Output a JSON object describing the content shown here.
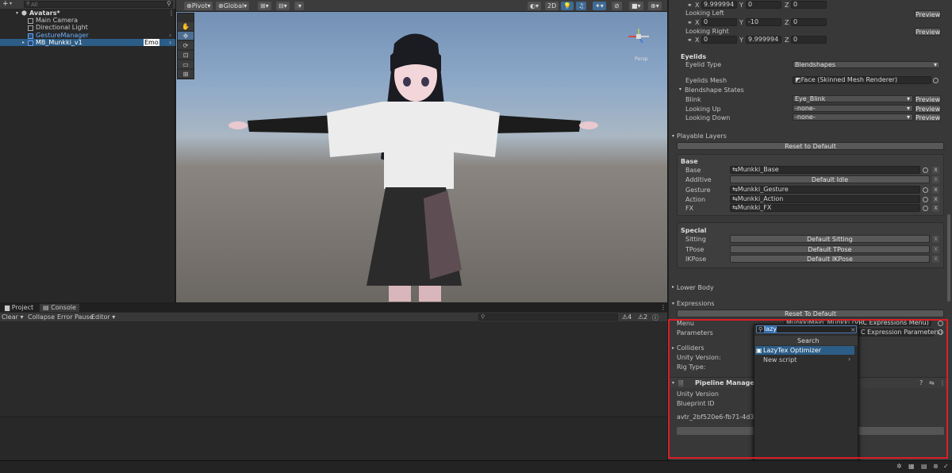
{
  "hierarchy": {
    "add": "+",
    "search_placeholder": "All",
    "root": "Avatars*",
    "items": [
      {
        "label": "Main Camera"
      },
      {
        "label": "Directional Light"
      },
      {
        "label": "GestureManager"
      },
      {
        "label": "MB_Munkki_v1",
        "badge": "Emo"
      }
    ]
  },
  "scene_toolbar": {
    "pivot": "Pivot",
    "global": "Global",
    "mode_2d": "2D"
  },
  "scene_tools": [
    "hand-icon",
    "move-icon",
    "rotate-icon",
    "scale-icon",
    "rect-icon",
    "transform-icon"
  ],
  "bottom": {
    "tabs": [
      "Project",
      "Console"
    ],
    "console_buttons": [
      "Clear",
      "Collapse",
      "Error Pause",
      "Editor"
    ],
    "warnings_count": "4",
    "errors_count": "2"
  },
  "inspector": {
    "top_vec": {
      "x": "9.999994",
      "y": "0",
      "z": "0"
    },
    "looking_left": {
      "label": "Looking Left",
      "x": "0",
      "y": "-10",
      "z": "0"
    },
    "looking_right": {
      "label": "Looking Right",
      "x": "0",
      "y": "9.999994",
      "z": "0"
    },
    "preview": "Preview",
    "eyelids": {
      "header": "Eyelids",
      "type_label": "Eyelid Type",
      "type_value": "Blendshapes",
      "mesh_label": "Eyelids Mesh",
      "mesh_value": "Face (Skinned Mesh Renderer)",
      "states_label": "Blendshape States",
      "rows": [
        {
          "label": "Blink",
          "value": "Eye_Blink"
        },
        {
          "label": "Looking Up",
          "value": "-none-"
        },
        {
          "label": "Looking Down",
          "value": "-none-"
        }
      ]
    },
    "playable": {
      "header": "Playable Layers",
      "reset": "Reset to Default",
      "base_header": "Base",
      "base_rows": [
        {
          "label": "Base",
          "value": "Munkki_Base",
          "kind": "field"
        },
        {
          "label": "Additive",
          "value": "Default Idle",
          "kind": "button"
        },
        {
          "label": "Gesture",
          "value": "Munkki_Gesture",
          "kind": "field"
        },
        {
          "label": "Action",
          "value": "Munkki_Action",
          "kind": "field"
        },
        {
          "label": "FX",
          "value": "Munkki_FX",
          "kind": "field"
        }
      ],
      "special_header": "Special",
      "special_rows": [
        {
          "label": "Sitting",
          "value": "Default Sitting"
        },
        {
          "label": "TPose",
          "value": "Default TPose"
        },
        {
          "label": "IKPose",
          "value": "Default IKPose"
        }
      ],
      "x": "X"
    },
    "lower_body": "Lower Body",
    "expressions": {
      "header": "Expressions",
      "reset": "Reset To Default",
      "menu_label": "Menu",
      "menu_value": "MunkkiMain_Munkki (VRC Expressions Menu)",
      "params_label": "Parameters",
      "params_value": "C Expression Parameters)"
    },
    "colliders": "Colliders",
    "unity_version": "Unity Version:",
    "rig_type": "Rig Type:",
    "pipeline": {
      "title": "Pipeline Manager (Sc",
      "unity_version": "Unity Version",
      "blueprint_id": "Blueprint ID",
      "avatar_id": "avtr_2bf520e6-fb71-4d3d-b"
    }
  },
  "popup": {
    "search_value": "lazy",
    "header": "Search",
    "items": [
      {
        "label": "LazyTex Optimizer",
        "selected": true
      },
      {
        "label": "New script",
        "selected": false
      }
    ]
  },
  "colors": {
    "selection": "#2c5d87",
    "highlight_box": "#d91f26",
    "popup_selected": "#2c5d87"
  }
}
